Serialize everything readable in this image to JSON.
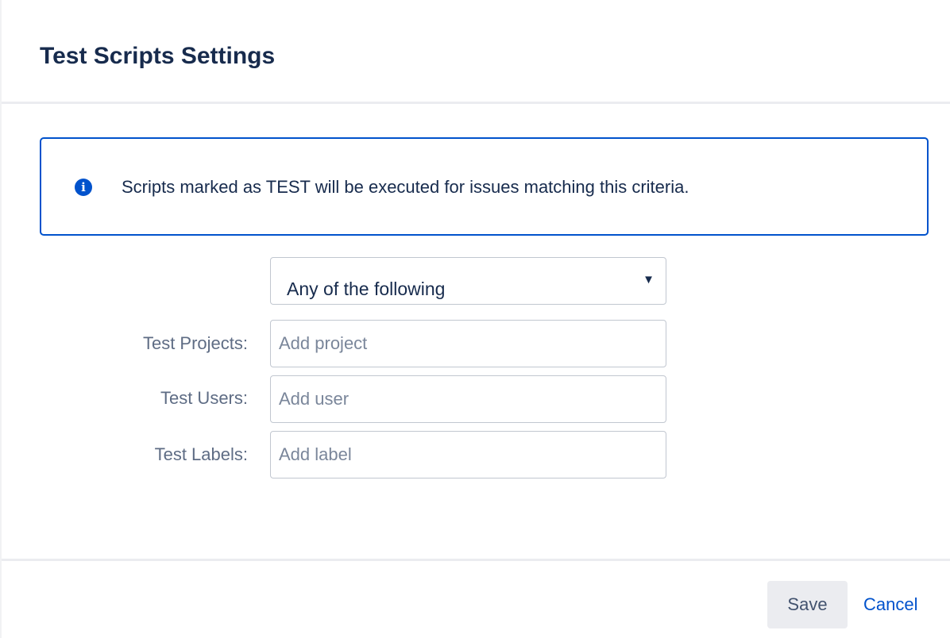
{
  "dialog": {
    "title": "Test Scripts Settings"
  },
  "info": {
    "icon": "info-icon",
    "icon_glyph": "i",
    "message": "Scripts marked as TEST will be executed for issues matching this criteria."
  },
  "match_select": {
    "selected": "Any of the following",
    "arrow": "▼"
  },
  "fields": {
    "projects": {
      "label": "Test Projects:",
      "placeholder": "Add project"
    },
    "users": {
      "label": "Test Users:",
      "placeholder": "Add user"
    },
    "labels": {
      "label": "Test Labels:",
      "placeholder": "Add label"
    }
  },
  "footer": {
    "save_label": "Save",
    "cancel_label": "Cancel"
  },
  "colors": {
    "accent": "#0052cc",
    "title_text": "#172b4d",
    "label_text": "#5e6c84",
    "button_bg": "#ebecf0"
  }
}
